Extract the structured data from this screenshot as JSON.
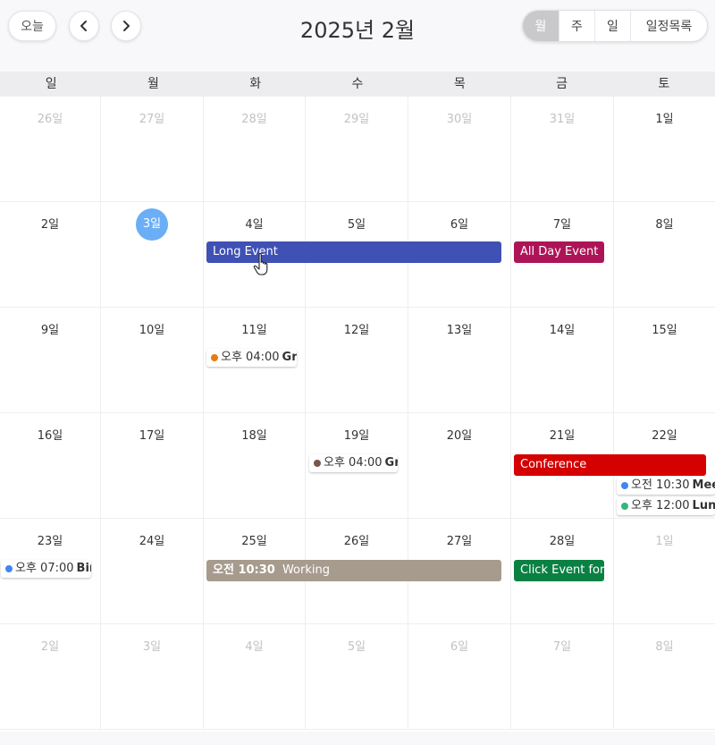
{
  "toolbar": {
    "today_label": "오늘",
    "title": "2025년 2월",
    "views": [
      {
        "label": "월",
        "active": true
      },
      {
        "label": "주",
        "active": false
      },
      {
        "label": "일",
        "active": false
      },
      {
        "label": "일정목록",
        "active": false
      }
    ]
  },
  "weekdays": [
    "일",
    "월",
    "화",
    "수",
    "목",
    "금",
    "토"
  ],
  "weeks": [
    [
      {
        "label": "26일",
        "other": true
      },
      {
        "label": "27일",
        "other": true
      },
      {
        "label": "28일",
        "other": true
      },
      {
        "label": "29일",
        "other": true
      },
      {
        "label": "30일",
        "other": true
      },
      {
        "label": "31일",
        "other": true
      },
      {
        "label": "1일"
      }
    ],
    [
      {
        "label": "2일"
      },
      {
        "label": "3일",
        "today": true
      },
      {
        "label": "4일"
      },
      {
        "label": "5일"
      },
      {
        "label": "6일"
      },
      {
        "label": "7일"
      },
      {
        "label": "8일"
      }
    ],
    [
      {
        "label": "9일"
      },
      {
        "label": "10일"
      },
      {
        "label": "11일"
      },
      {
        "label": "12일"
      },
      {
        "label": "13일"
      },
      {
        "label": "14일"
      },
      {
        "label": "15일"
      }
    ],
    [
      {
        "label": "16일"
      },
      {
        "label": "17일"
      },
      {
        "label": "18일"
      },
      {
        "label": "19일"
      },
      {
        "label": "20일"
      },
      {
        "label": "21일"
      },
      {
        "label": "22일"
      }
    ],
    [
      {
        "label": "23일"
      },
      {
        "label": "24일"
      },
      {
        "label": "25일"
      },
      {
        "label": "26일"
      },
      {
        "label": "27일"
      },
      {
        "label": "28일"
      },
      {
        "label": "1일",
        "other": true
      }
    ],
    [
      {
        "label": "2일",
        "other": true
      },
      {
        "label": "3일",
        "other": true
      },
      {
        "label": "4일",
        "other": true
      },
      {
        "label": "5일",
        "other": true
      },
      {
        "label": "6일",
        "other": true
      },
      {
        "label": "7일",
        "other": true
      },
      {
        "label": "8일",
        "other": true
      }
    ]
  ],
  "events": {
    "long_event": {
      "title": "Long Event",
      "color": "#3f51b5"
    },
    "all_day_event": {
      "title": "All Day Event",
      "color": "#ad1457"
    },
    "conference": {
      "title": "Conference",
      "color": "#d50000"
    },
    "working": {
      "time": "오전 10:30",
      "title": "Working",
      "color": "#a79b8e"
    },
    "click_event": {
      "title": "Click Event for G",
      "color": "#0b8043"
    },
    "group_meeting_11": {
      "time": "오후 04:00",
      "title": "Gro",
      "dot_color": "#e67c0f"
    },
    "group_meeting_19": {
      "time": "오후 04:00",
      "title": "Gro",
      "dot_color": "#795548"
    },
    "meeting_22": {
      "time": "오전 10:30",
      "title": "Mee",
      "dot_color": "#4285f4"
    },
    "lunch_22": {
      "time": "오후 12:00",
      "title": "Lun",
      "dot_color": "#33b679"
    },
    "birthday_23": {
      "time": "오후 07:00",
      "title": "Birt",
      "dot_color": "#4285f4"
    }
  }
}
